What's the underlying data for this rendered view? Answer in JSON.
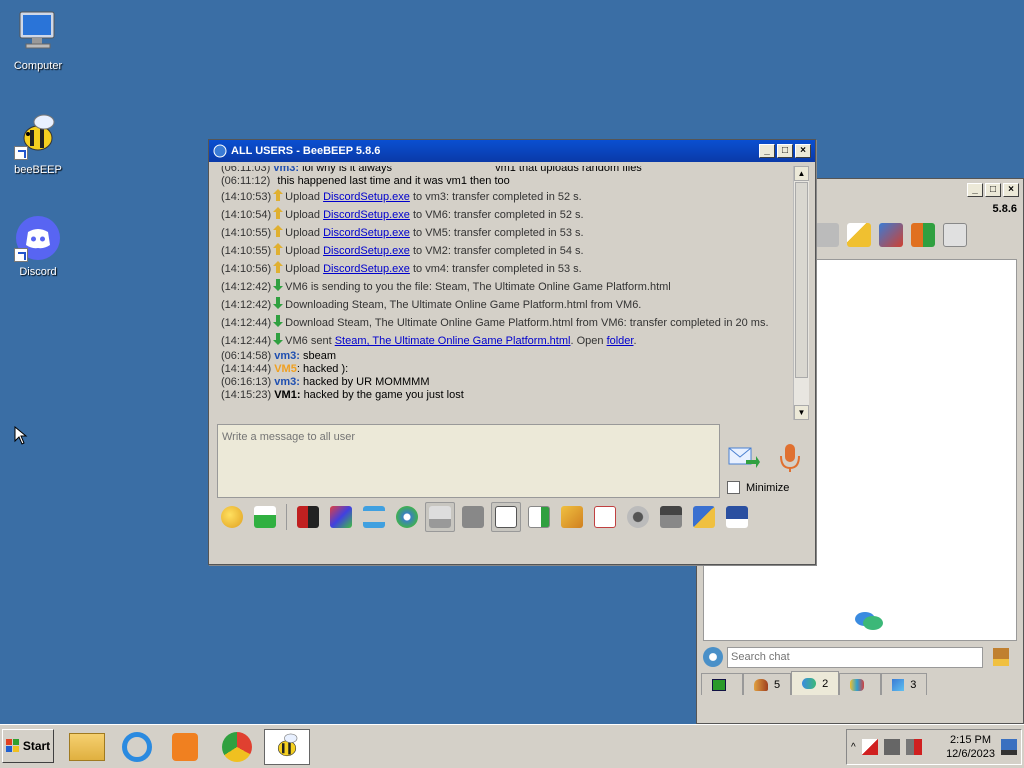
{
  "desktop": {
    "icons": [
      {
        "label": "Computer",
        "icon": "computer-icon"
      },
      {
        "label": "beeBEEP",
        "icon": "bee-icon"
      },
      {
        "label": "Discord",
        "icon": "discord-icon"
      }
    ]
  },
  "main_window": {
    "version": "5.8.6",
    "search_placeholder": "Search chat",
    "tabs": [
      {
        "icon": "green-screen-icon",
        "count": ""
      },
      {
        "icon": "users-icon",
        "count": "5"
      },
      {
        "icon": "chat-bubbles-icon",
        "count": "2"
      },
      {
        "icon": "groups-icon",
        "count": ""
      },
      {
        "icon": "shares-icon",
        "count": "3"
      }
    ]
  },
  "chat_window": {
    "title": "ALL USERS - BeeBEEP 5.8.6",
    "messages": {
      "m0": {
        "ts": "(06:11:03)",
        "user": "vm3:",
        "text": "lol why is it always",
        "trail": "vm1 that uploads random files"
      },
      "m1": {
        "ts": "(06:11:12)",
        "text": "this happened last time and it was vm1 then too"
      },
      "m2": {
        "ts": "(14:10:53)",
        "pre": "Upload",
        "link": "DiscordSetup.exe",
        "post": "to vm3: transfer completed in 52 s."
      },
      "m3": {
        "ts": "(14:10:54)",
        "pre": "Upload",
        "link": "DiscordSetup.exe",
        "post": "to VM6: transfer completed in 52 s."
      },
      "m4": {
        "ts": "(14:10:55)",
        "pre": "Upload",
        "link": "DiscordSetup.exe",
        "post": "to VM5: transfer completed in 53 s."
      },
      "m5": {
        "ts": "(14:10:55)",
        "pre": "Upload",
        "link": "DiscordSetup.exe",
        "post": "to VM2: transfer completed in 54 s."
      },
      "m6": {
        "ts": "(14:10:56)",
        "pre": "Upload",
        "link": "DiscordSetup.exe",
        "post": "to vm4: transfer completed in 53 s."
      },
      "m7": {
        "ts": "(14:12:42)",
        "text": "VM6 is sending to you the file: Steam, The Ultimate Online Game Platform.html"
      },
      "m8": {
        "ts": "(14:12:42)",
        "text": "Downloading Steam, The Ultimate Online Game Platform.html from VM6."
      },
      "m9": {
        "ts": "(14:12:44)",
        "text": "Download Steam, The Ultimate Online Game Platform.html from VM6: transfer completed in 20 ms."
      },
      "m10": {
        "ts": "(14:12:44)",
        "pre": "VM6 sent",
        "link": "Steam, The Ultimate Online Game Platform.html",
        "mid": ". Open",
        "link2": "folder",
        "end": "."
      },
      "m11": {
        "ts": "(06:14:58)",
        "user": "vm3:",
        "text": "sbeam"
      },
      "m12": {
        "ts": "(14:14:44)",
        "user": "VM5",
        "text": ": hacked ):"
      },
      "m13": {
        "ts": "(06:16:13)",
        "user": "vm3:",
        "text": "hacked by UR MOMMMM"
      },
      "m14": {
        "ts": "(14:15:23)",
        "user": "VM1:",
        "text": "hacked by the game you just lost"
      }
    },
    "composer_placeholder": "Write a message to all user",
    "minimize_label": "Minimize"
  },
  "taskbar": {
    "start_label": "Start",
    "time": "2:15 PM",
    "date": "12/6/2023"
  },
  "colors": {
    "desktop": "#3a6ea5",
    "title_active": "#0a4fd1",
    "user_blue": "#1f4fb0",
    "user_orange": "#f0a020",
    "link": "#0000cc"
  }
}
